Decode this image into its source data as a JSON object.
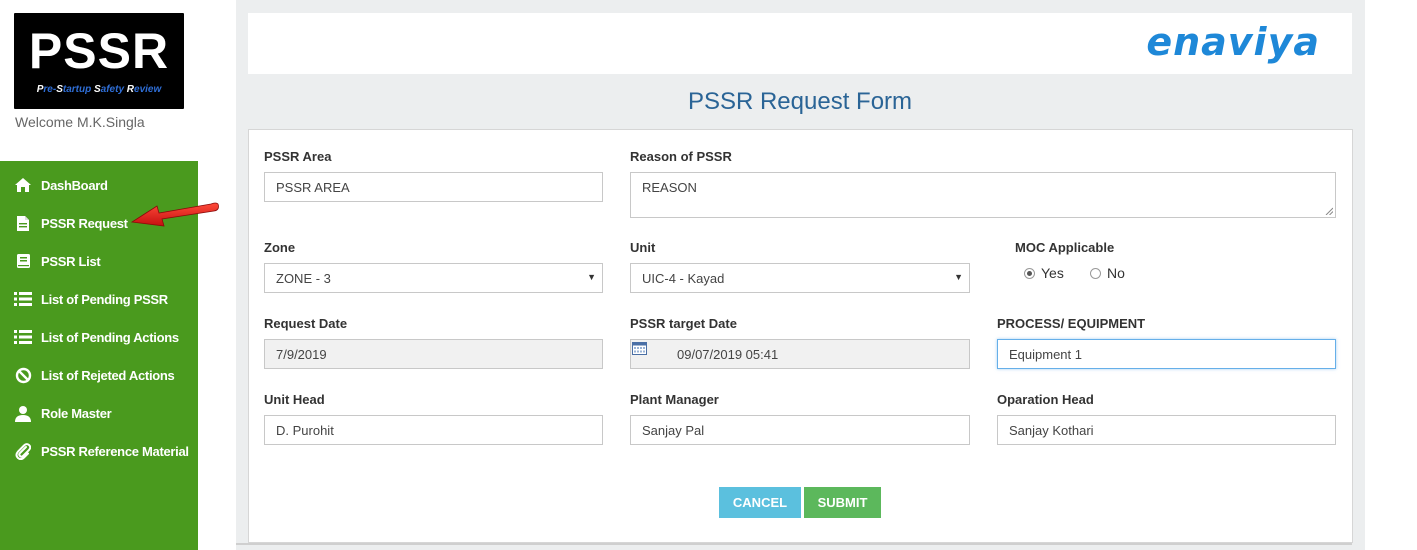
{
  "app": {
    "logo_main": "PSSR",
    "logo_sub_parts": [
      "P",
      "re-",
      "S",
      "tartup ",
      "S",
      "afety ",
      "R",
      "eview"
    ],
    "welcome": "Welcome M.K.Singla",
    "brand": "enaviya"
  },
  "sidebar": {
    "items": [
      {
        "label": "DashBoard",
        "icon": "home-icon"
      },
      {
        "label": "PSSR Request",
        "icon": "file-icon"
      },
      {
        "label": "PSSR List",
        "icon": "book-icon"
      },
      {
        "label": "List of Pending PSSR",
        "icon": "list-icon"
      },
      {
        "label": "List of Pending Actions",
        "icon": "list-icon"
      },
      {
        "label": "List of Rejeted Actions",
        "icon": "ban-icon"
      },
      {
        "label": "Role Master",
        "icon": "user-icon"
      },
      {
        "label": "PSSR Reference Material",
        "icon": "paperclip-icon"
      }
    ],
    "annotation_arrow_color": "#e02020"
  },
  "page": {
    "title": "PSSR Request Form"
  },
  "form": {
    "pssr_area": {
      "label": "PSSR Area",
      "value": "PSSR AREA"
    },
    "reason": {
      "label": "Reason of PSSR",
      "value": "REASON"
    },
    "zone": {
      "label": "Zone",
      "value": "ZONE - 3"
    },
    "unit": {
      "label": "Unit",
      "value": "UIC-4 - Kayad"
    },
    "moc": {
      "label": "MOC Applicable",
      "yes": "Yes",
      "no": "No",
      "selected": "Yes"
    },
    "request_date": {
      "label": "Request Date",
      "value": "7/9/2019"
    },
    "target_date": {
      "label": "PSSR target Date",
      "value": "09/07/2019 05:41"
    },
    "process_equipment": {
      "label": "PROCESS/ EQUIPMENT",
      "value": "Equipment 1"
    },
    "unit_head": {
      "label": "Unit Head",
      "value": "D. Purohit"
    },
    "plant_manager": {
      "label": "Plant Manager",
      "value": "Sanjay Pal"
    },
    "operation_head": {
      "label": "Oparation Head",
      "value": "Sanjay Kothari"
    },
    "cancel_label": "CANCEL",
    "submit_label": "SUBMIT"
  },
  "colors": {
    "sidebar": "#4a9a1e",
    "title": "#2a6496",
    "brand": "#1e88d8",
    "cancel": "#5bc0de",
    "submit": "#5cb85c"
  }
}
